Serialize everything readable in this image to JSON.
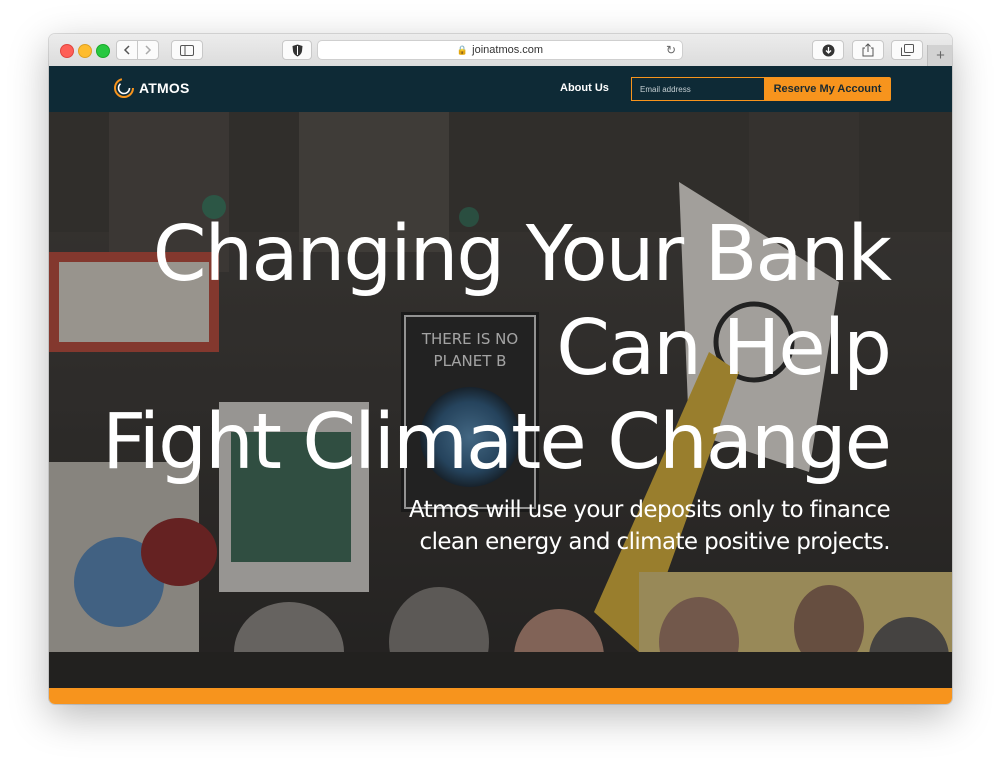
{
  "browser": {
    "url": "joinatmos.com",
    "new_tab_symbol": "+"
  },
  "header": {
    "logo_text": "ATMOS",
    "nav_about": "About Us",
    "email_placeholder": "Email address",
    "reserve_button": "Reserve My Account"
  },
  "hero": {
    "headline_lines": [
      "Changing Your Bank",
      "Can Help",
      "Fight Climate Change"
    ],
    "subhead_lines": [
      "Atmos will use your deposits only to finance",
      "clean energy and climate positive projects."
    ],
    "sign_text": [
      "THERE IS NO",
      "PLANET B"
    ]
  },
  "colors": {
    "header_bg": "#0e2a36",
    "accent_orange": "#f7941d"
  }
}
